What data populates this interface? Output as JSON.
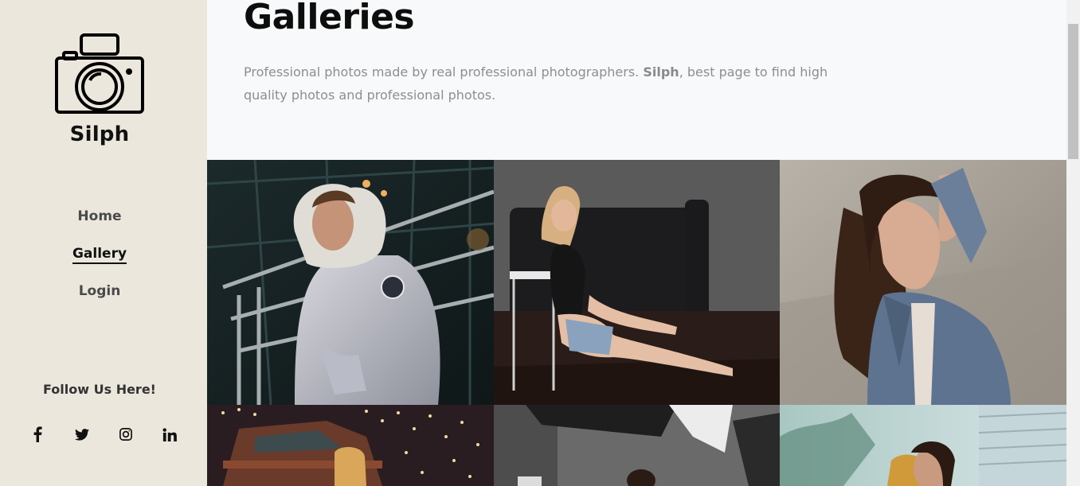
{
  "sidebar": {
    "logo_icon": "camera-icon",
    "brand": "Silph",
    "nav": [
      {
        "label": "Home",
        "active": false
      },
      {
        "label": "Gallery",
        "active": true
      },
      {
        "label": "Login",
        "active": false
      }
    ],
    "follow_label": "Follow Us Here!",
    "socials": [
      {
        "icon": "facebook-icon",
        "glyph": "f"
      },
      {
        "icon": "twitter-icon",
        "glyph": ""
      },
      {
        "icon": "instagram-icon",
        "glyph": ""
      },
      {
        "icon": "linkedin-icon",
        "glyph": "in"
      }
    ]
  },
  "main": {
    "title": "Galleries",
    "description_before": "Professional photos made by real professional photographers. ",
    "description_brand": "Silph",
    "description_after": ", best page to find high quality photos and professional photos."
  },
  "gallery": {
    "photos": [
      {
        "subject": "man-in-winter-jacket-photo",
        "accent": "#b9bcc7"
      },
      {
        "subject": "woman-sitting-on-floor-photo",
        "accent": "#3a3a3a"
      },
      {
        "subject": "woman-in-denim-jacket-photo",
        "accent": "#6b7f9b"
      },
      {
        "subject": "woman-by-old-truck-photo",
        "accent": "#6a3b2a"
      },
      {
        "subject": "person-with-umbrella-photo",
        "accent": "#e8e8e8"
      },
      {
        "subject": "woman-in-yellow-top-photo",
        "accent": "#d09a3a"
      }
    ]
  },
  "colors": {
    "sidebar_bg": "#ebe7dc",
    "main_bg": "#f8f9fa",
    "text_dark": "#111111",
    "text_muted": "#8e8e8e"
  }
}
